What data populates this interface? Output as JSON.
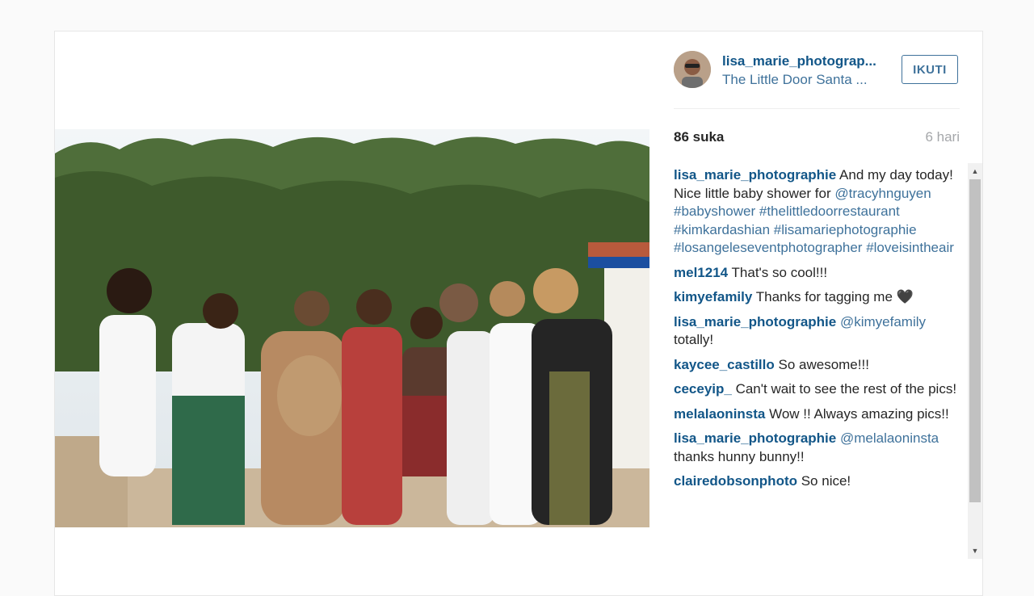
{
  "post": {
    "username": "lisa_marie_photograp...",
    "location": "The Little Door Santa ...",
    "follow_label": "IKUTI",
    "likes": "86 suka",
    "time": "6 hari"
  },
  "comments": [
    {
      "author": "lisa_marie_photographie",
      "parts": [
        {
          "t": " And my day today! Nice little baby shower for ",
          "tag": false
        },
        {
          "t": "@tracyhnguyen",
          "tag": true
        },
        {
          "t": " ",
          "tag": false
        },
        {
          "t": "#babyshower",
          "tag": true
        },
        {
          "t": " ",
          "tag": false
        },
        {
          "t": "#thelittledoorrestaurant",
          "tag": true
        },
        {
          "t": " ",
          "tag": false
        },
        {
          "t": "#kimkardashian",
          "tag": true
        },
        {
          "t": " ",
          "tag": false
        },
        {
          "t": "#lisamariephotographie",
          "tag": true
        },
        {
          "t": " ",
          "tag": false
        },
        {
          "t": "#losangeleseventphotographer",
          "tag": true
        },
        {
          "t": " ",
          "tag": false
        },
        {
          "t": "#loveisintheair",
          "tag": true
        }
      ]
    },
    {
      "author": "mel1214",
      "parts": [
        {
          "t": " That's so cool!!!",
          "tag": false
        }
      ]
    },
    {
      "author": "kimyefamily",
      "parts": [
        {
          "t": " Thanks for tagging me 🖤",
          "tag": false
        }
      ]
    },
    {
      "author": "lisa_marie_photographie",
      "parts": [
        {
          "t": " ",
          "tag": false
        },
        {
          "t": "@kimyefamily",
          "tag": true
        },
        {
          "t": " totally!",
          "tag": false
        }
      ]
    },
    {
      "author": "kaycee_castillo",
      "parts": [
        {
          "t": " So awesome!!!",
          "tag": false
        }
      ]
    },
    {
      "author": "ceceyip_",
      "parts": [
        {
          "t": " Can't wait to see the rest of the pics!",
          "tag": false
        }
      ]
    },
    {
      "author": "melalaoninsta",
      "parts": [
        {
          "t": " Wow !! Always amazing pics!!",
          "tag": false
        }
      ]
    },
    {
      "author": "lisa_marie_photographie",
      "parts": [
        {
          "t": " ",
          "tag": false
        },
        {
          "t": "@melalaoninsta",
          "tag": true
        },
        {
          "t": " thanks hunny bunny!!",
          "tag": false
        }
      ]
    },
    {
      "author": "clairedobsonphoto",
      "parts": [
        {
          "t": " So nice!",
          "tag": false
        }
      ]
    }
  ],
  "icons": {
    "scroll_up": "scroll-up-arrow-icon",
    "scroll_down": "scroll-down-arrow-icon"
  },
  "colors": {
    "link": "#125688",
    "tag": "#3f729b",
    "muted": "#a5a7aa"
  }
}
